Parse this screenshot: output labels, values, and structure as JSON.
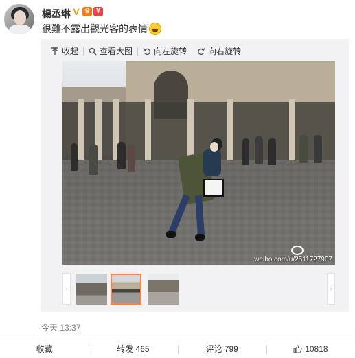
{
  "post": {
    "username": "楊丞琳",
    "text": "很難不露出觀光客的表情",
    "emoji": "laughing-emoji",
    "timestamp": "今天 13:37"
  },
  "toolbar": {
    "collapse": "收起",
    "view_large": "查看大图",
    "rotate_left": "向左旋转",
    "rotate_right": "向右旋转"
  },
  "photo": {
    "watermark": "weibo.com/u/2511727907"
  },
  "gallery": {
    "thumbnails": [
      "thumb-1",
      "thumb-2",
      "thumb-3"
    ],
    "selected_index": 1
  },
  "actions": {
    "favorite": "收藏",
    "repost": "转发 465",
    "comment": "评论 799",
    "like": "10818"
  },
  "colors": {
    "selected_thumb_border": "#ff8140",
    "media_background": "#f2f2f5",
    "verified_badge": "#f3a100"
  }
}
